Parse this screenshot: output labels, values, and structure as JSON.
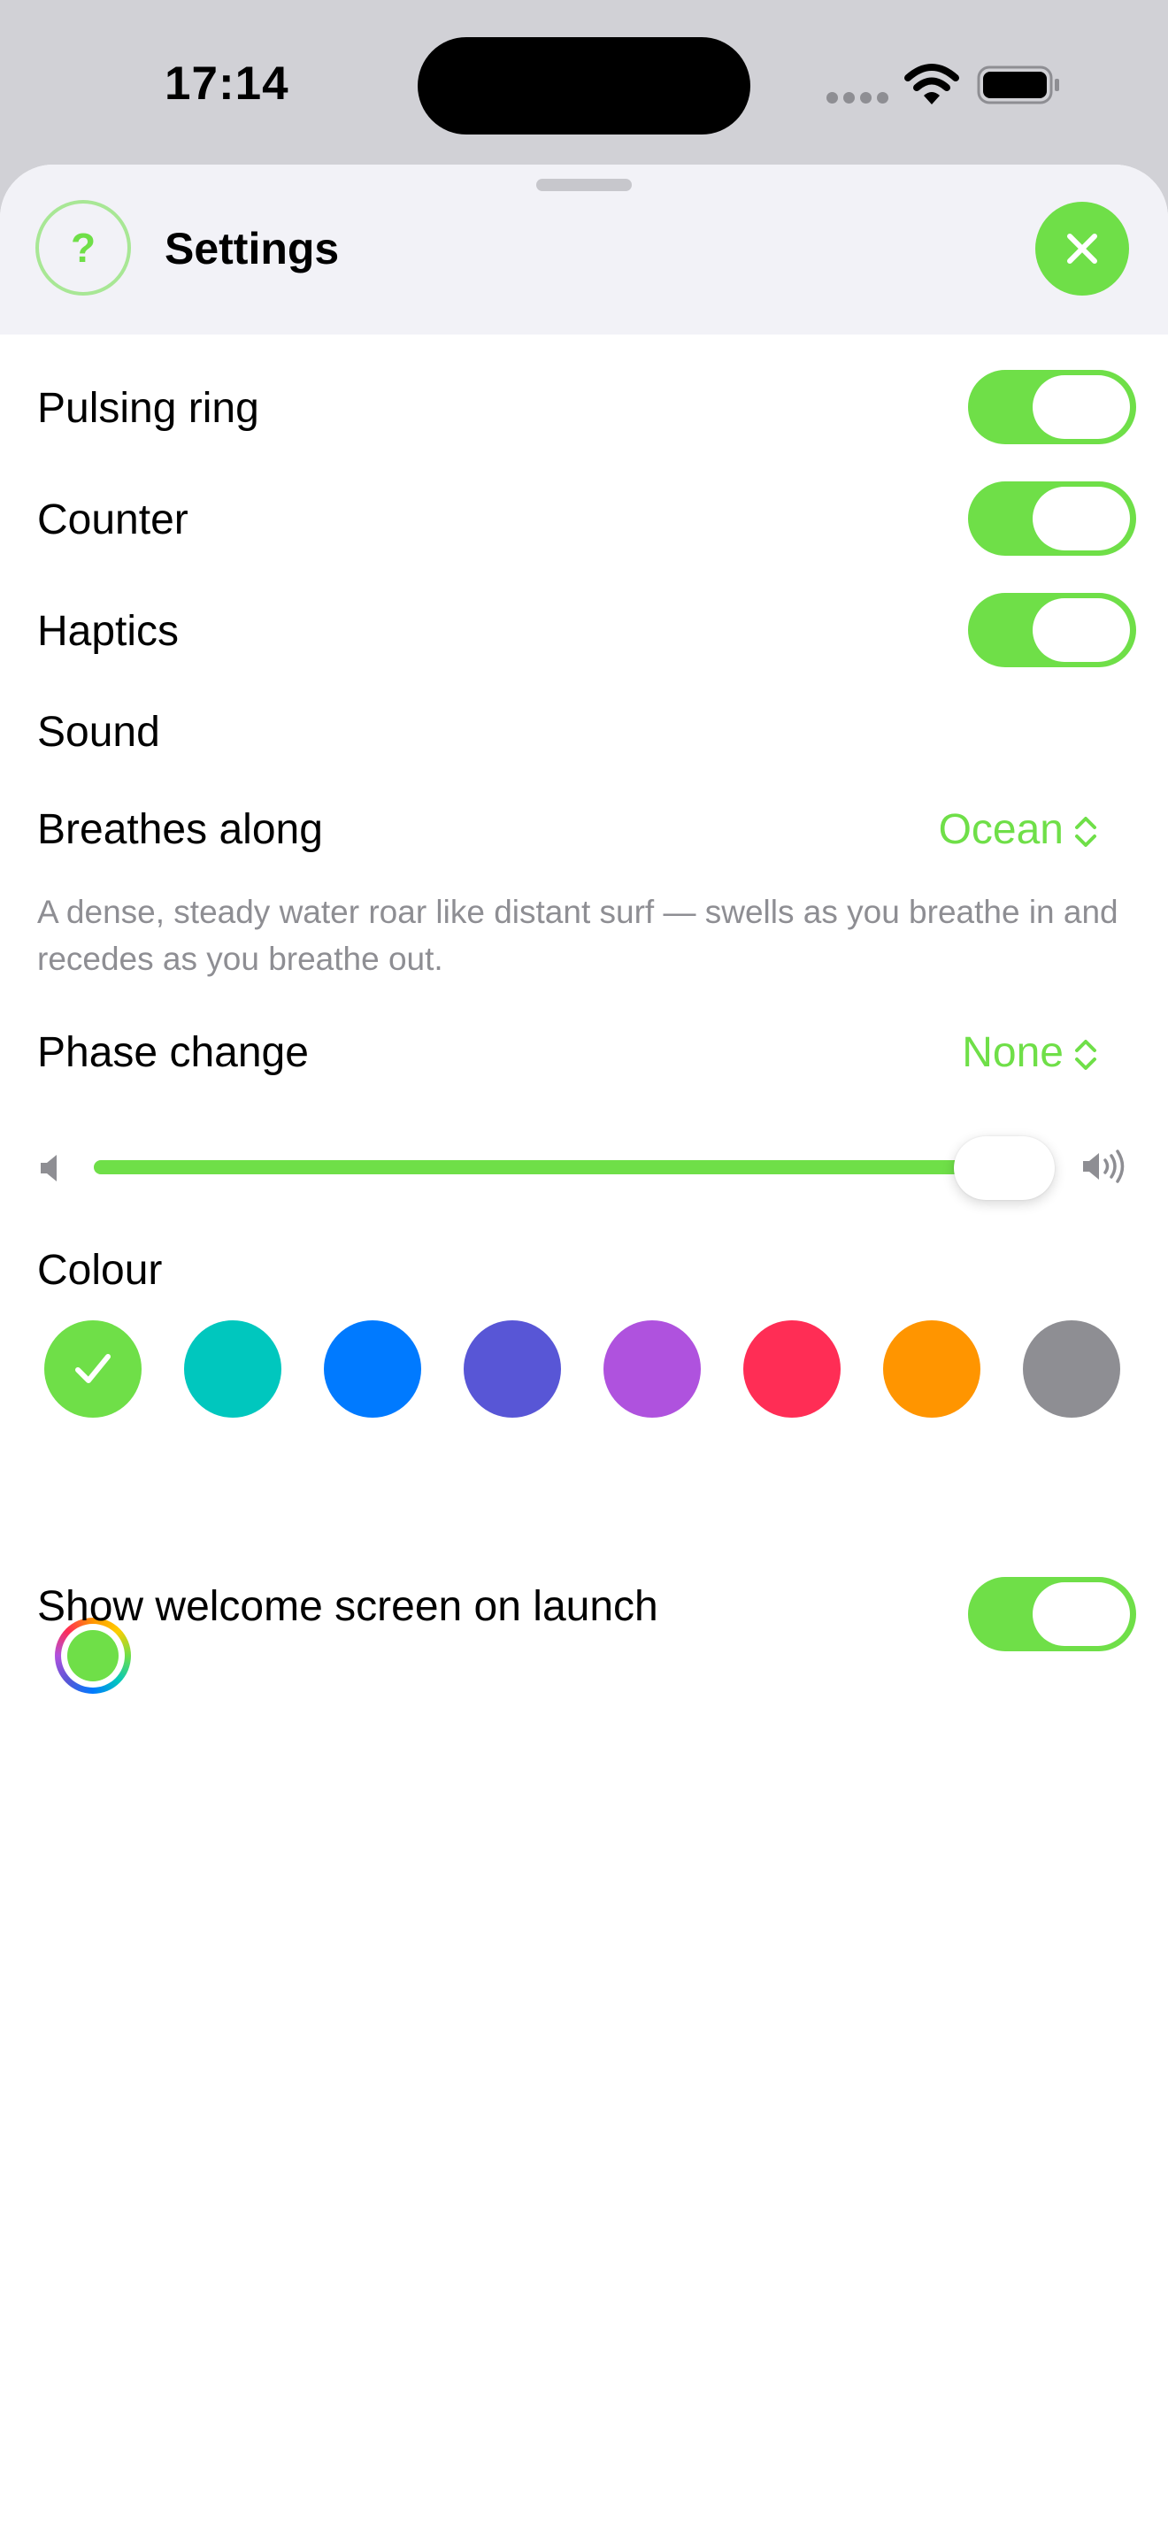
{
  "status_bar": {
    "time": "17:14"
  },
  "header": {
    "title": "Settings",
    "help_symbol": "?",
    "close_icon": "xmark-icon"
  },
  "settings": {
    "pulsing_ring": {
      "label": "Pulsing ring",
      "on": true
    },
    "counter": {
      "label": "Counter",
      "on": true
    },
    "haptics": {
      "label": "Haptics",
      "on": true
    },
    "sound": {
      "section_label": "Sound",
      "breathes_along": {
        "label": "Breathes along",
        "value": "Ocean"
      },
      "description": "A dense, steady water roar like distant surf — swells as you breathe in and recedes as you breathe out.",
      "phase_change": {
        "label": "Phase change",
        "value": "None"
      },
      "volume_fraction": 0.92
    },
    "colour": {
      "label": "Colour",
      "selected_index": 0,
      "swatches": [
        "#6fdf48",
        "#00c7be",
        "#007aff",
        "#5856d6",
        "#af52de",
        "#ff2d55",
        "#ff9500",
        "#8e8e93"
      ],
      "custom_picker_icon": "color-wheel-icon"
    },
    "show_welcome": {
      "label": "Show welcome screen on launch",
      "on": true
    }
  },
  "colors": {
    "accent": "#6fdf48",
    "secondary_text": "#8e8e93",
    "header_bg": "#f2f2f7"
  }
}
